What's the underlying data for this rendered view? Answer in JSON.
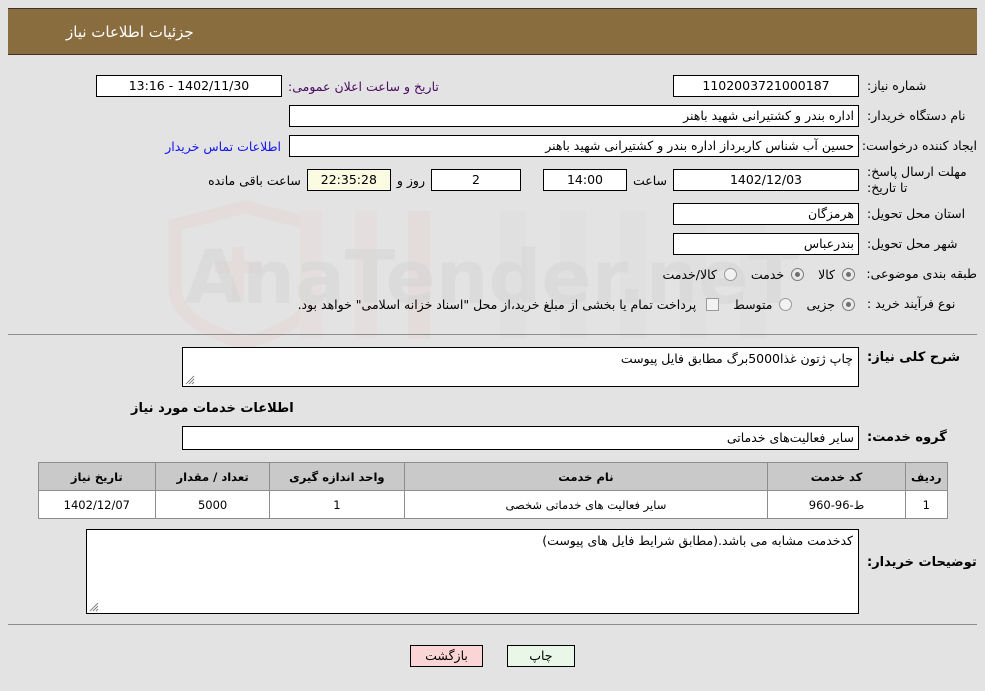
{
  "header": {
    "title": "جزئیات اطلاعات نیاز"
  },
  "watermark": {
    "text": "AnaTender.neT"
  },
  "form": {
    "need_number_label": "شماره نیاز:",
    "need_number_value": "1102003721000187",
    "announce_datetime_label": "تاریخ و ساعت اعلان عمومی:",
    "announce_datetime_value": "1402/11/30 - 13:16",
    "buyer_org_label": "نام دستگاه خریدار:",
    "buyer_org_value": "اداره بندر و کشتیرانی شهید باهنر",
    "requester_label": "ایجاد کننده درخواست:",
    "requester_value": "حسین آب شناس کاربرداز اداره بندر و کشتیرانی شهید باهنر",
    "contact_link": "اطلاعات تماس خریدار",
    "deadline_label": "مهلت ارسال پاسخ: تا تاریخ:",
    "deadline_date": "1402/12/03",
    "deadline_hour_label": "ساعت",
    "deadline_time": "14:00",
    "remaining_days": "2",
    "remaining_days_label": "روز و",
    "remaining_time": "22:35:28",
    "remaining_suffix_label": "ساعت باقی مانده",
    "province_label": "استان محل تحویل:",
    "province_value": "هرمزگان",
    "city_label": "شهر محل تحویل:",
    "city_value": "بندرعباس",
    "category_label": "طبقه بندی موضوعی:",
    "category_options": [
      {
        "label": "کالا",
        "selected": false
      },
      {
        "label": "خدمت",
        "selected": true
      },
      {
        "label": "کالا/خدمت",
        "selected": false
      }
    ],
    "process_label": "نوع فرآیند خرید :",
    "process_options": [
      {
        "label": "جزیی",
        "selected": true
      },
      {
        "label": "متوسط",
        "selected": false
      }
    ],
    "treasury_checkbox_label": "پرداخت تمام یا بخشی از مبلغ خرید،از محل \"اسناد خزانه اسلامی\" خواهد بود.",
    "treasury_checked": false
  },
  "description": {
    "general_label": "شرح کلی نیاز:",
    "general_value": "چاپ ژتون غذا5000برگ مطابق فایل پیوست",
    "services_heading": "اطلاعات خدمات مورد نیاز",
    "group_label": "گروه خدمت:",
    "group_value": "سایر فعالیت‌های خدماتی"
  },
  "table": {
    "headers": [
      "ردیف",
      "کد خدمت",
      "نام خدمت",
      "واحد اندازه گیری",
      "تعداد / مقدار",
      "تاریخ نیاز"
    ],
    "rows": [
      {
        "index": "1",
        "code": "ط-96-960",
        "name": "سایر فعالیت های خدماتی شخصی",
        "unit": "1",
        "quantity": "5000",
        "need_date": "1402/12/07"
      }
    ]
  },
  "buyer_notes": {
    "label": "توضیحات خریدار:",
    "value": "کدخدمت مشابه می باشد.(مطابق شرایط فایل های پیوست)"
  },
  "footer": {
    "print_label": "چاپ",
    "back_label": "بازگشت"
  },
  "colors": {
    "header_bg": "#8a6d3f",
    "page_bg": "#e3e3e3",
    "link": "#1414ef",
    "label_purple": "#4b0a60",
    "print_btn": "#e8f7e8",
    "back_btn": "#fbd5d5",
    "countdown_bg": "#fbfbe2",
    "table_header_bg": "#c9c9c9"
  }
}
